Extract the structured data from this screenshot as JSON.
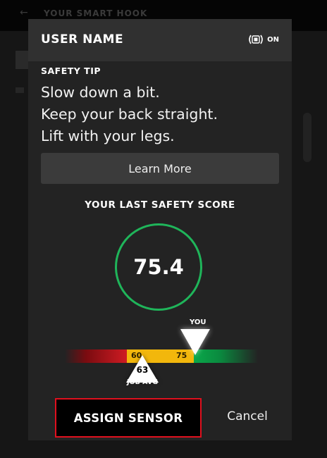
{
  "background": {
    "title": "YOUR SMART HOOK",
    "back_icon": "back-arrow-icon"
  },
  "modal": {
    "user_name": "USER NAME",
    "connection": {
      "icon": "sensor-connected-icon",
      "status": "ON"
    },
    "tip": {
      "label": "SAFETY TIP",
      "lines": [
        "Slow down a bit.",
        "Keep your back straight.",
        "Lift with your legs."
      ]
    },
    "learn_more_label": "Learn More",
    "score": {
      "title": "YOUR LAST SAFETY SCORE",
      "value": "75.4",
      "ring_color": "#1fb55a"
    },
    "gauge": {
      "tick_low": "60",
      "tick_high": "75",
      "you_label": "YOU",
      "you_value": 75.4,
      "job_avg_value": "63",
      "job_avg_label": "JOB AVG",
      "colors": {
        "red": "#cc1b22",
        "yellow": "#f2b70c",
        "green": "#0aa84a"
      }
    },
    "assign_label": "ASSIGN SENSOR",
    "cancel_label": "Cancel",
    "assign_border_color": "#e0101e"
  }
}
